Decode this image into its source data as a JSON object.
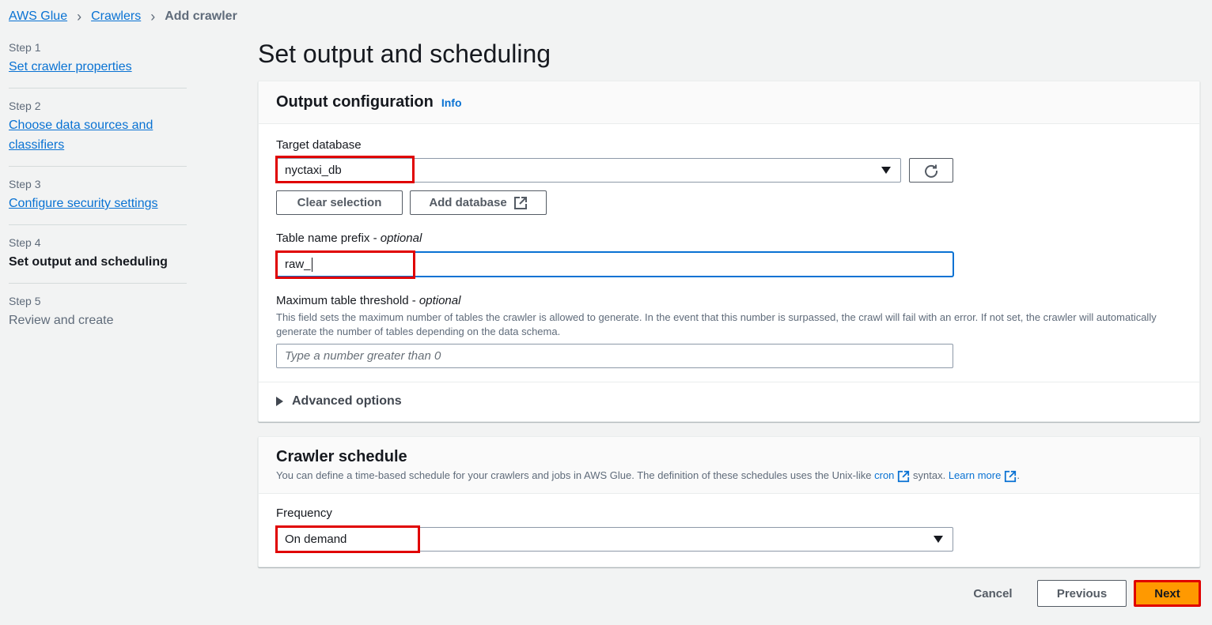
{
  "breadcrumb": {
    "item1": "AWS Glue",
    "item2": "Crawlers",
    "current": "Add crawler"
  },
  "steps": [
    {
      "num": "Step 1",
      "label": "Set crawler properties"
    },
    {
      "num": "Step 2",
      "label": "Choose data sources and classifiers"
    },
    {
      "num": "Step 3",
      "label": "Configure security settings"
    },
    {
      "num": "Step 4",
      "label": "Set output and scheduling"
    },
    {
      "num": "Step 5",
      "label": "Review and create"
    }
  ],
  "page_title": "Set output and scheduling",
  "output": {
    "title": "Output configuration",
    "info": "Info",
    "target_db_label": "Target database",
    "target_db_value": "nyctaxi_db",
    "clear_selection": "Clear selection",
    "add_database": "Add database",
    "prefix_label": "Table name prefix - ",
    "prefix_optional": "optional",
    "prefix_value": "raw_",
    "threshold_label": "Maximum table threshold - ",
    "threshold_optional": "optional",
    "threshold_desc": "This field sets the maximum number of tables the crawler is allowed to generate. In the event that this number is surpassed, the crawl will fail with an error. If not set, the crawler will automatically generate the number of tables depending on the data schema.",
    "threshold_placeholder": "Type a number greater than 0",
    "advanced": "Advanced options"
  },
  "schedule": {
    "title": "Crawler schedule",
    "desc_prefix": "You can define a time-based schedule for your crawlers and jobs in AWS Glue. The definition of these schedules uses the Unix-like ",
    "cron_link": "cron",
    "desc_middle": " syntax. ",
    "learn_more": "Learn more",
    "desc_end": ".",
    "frequency_label": "Frequency",
    "frequency_value": "On demand"
  },
  "footer": {
    "cancel": "Cancel",
    "previous": "Previous",
    "next": "Next"
  },
  "colors": {
    "link": "#0972d3",
    "primary": "#ff9900",
    "highlight": "#e00000"
  }
}
